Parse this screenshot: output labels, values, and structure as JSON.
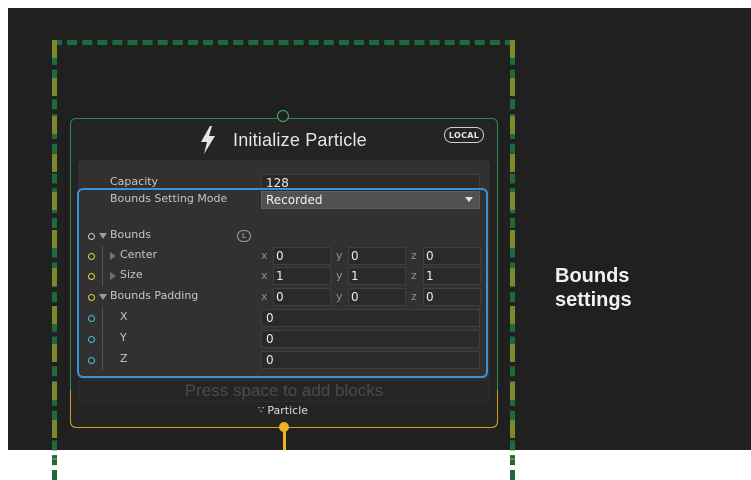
{
  "node": {
    "title": "Initialize Particle",
    "space_badge": "LOCAL",
    "context_label": "Particle",
    "add_block_hint": "Press space to add blocks"
  },
  "properties": {
    "capacity": {
      "label": "Capacity",
      "value": "128"
    },
    "bounds_mode": {
      "label": "Bounds Setting Mode",
      "value": "Recorded"
    },
    "bounds": {
      "label": "Bounds",
      "badge": "L"
    },
    "center": {
      "label": "Center",
      "x": "0",
      "y": "0",
      "z": "0"
    },
    "size": {
      "label": "Size",
      "x": "1",
      "y": "1",
      "z": "1"
    },
    "padding": {
      "label": "Bounds Padding",
      "x": "0",
      "y": "0",
      "z": "0"
    },
    "pad_x": {
      "label": "X",
      "value": "0"
    },
    "pad_y": {
      "label": "Y",
      "value": "0"
    },
    "pad_z": {
      "label": "Z",
      "value": "0"
    }
  },
  "axis_labels": {
    "x": "x",
    "y": "y",
    "z": "z"
  },
  "annotation": {
    "line1": "Bounds",
    "line2": "settings"
  },
  "colors": {
    "background": "#202020",
    "highlight": "#3a93d8",
    "node_border": "#2f8a57",
    "flow_port": "#f0b020",
    "vector_port": "#e0d23a",
    "float_port": "#49c1d0"
  }
}
